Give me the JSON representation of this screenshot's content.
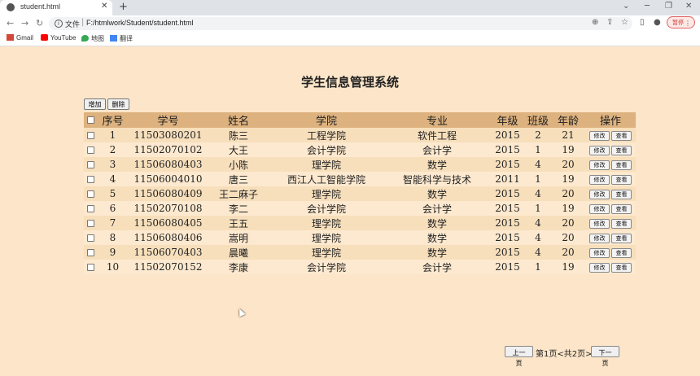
{
  "browser": {
    "tab_title": "student.html",
    "new_tab": "+",
    "address_label": "文件",
    "address_sep": "|",
    "url": "F:/htmlwork/Student/student.html",
    "profile_label": "暂停",
    "bookmarks": [
      {
        "label": "Gmail",
        "icon": "gmail-icon",
        "color": "#d44638"
      },
      {
        "label": "YouTube",
        "icon": "youtube-icon",
        "color": "#ff0000"
      },
      {
        "label": "地图",
        "icon": "maps-icon",
        "color": "#34a853"
      },
      {
        "label": "翻译",
        "icon": "translate-icon",
        "color": "#4285f4"
      }
    ]
  },
  "page": {
    "title": "学生信息管理系统",
    "add_label": "增加",
    "delete_label": "删除"
  },
  "table": {
    "headers": [
      "序号",
      "学号",
      "姓名",
      "学院",
      "专业",
      "年级",
      "班级",
      "年龄",
      "操作"
    ],
    "edit_label": "修改",
    "view_label": "查看",
    "rows": [
      {
        "no": "1",
        "id": "11503080201",
        "name": "陈三",
        "college": "工程学院",
        "major": "软件工程",
        "grade": "2015",
        "cls": "2",
        "age": "21"
      },
      {
        "no": "2",
        "id": "11502070102",
        "name": "大王",
        "college": "会计学院",
        "major": "会计学",
        "grade": "2015",
        "cls": "1",
        "age": "19"
      },
      {
        "no": "3",
        "id": "11506080403",
        "name": "小陈",
        "college": "理学院",
        "major": "数学",
        "grade": "2015",
        "cls": "4",
        "age": "20"
      },
      {
        "no": "4",
        "id": "11506004010",
        "name": "唐三",
        "college": "西江人工智能学院",
        "major": "智能科学与技术",
        "grade": "2011",
        "cls": "1",
        "age": "19"
      },
      {
        "no": "5",
        "id": "11506080409",
        "name": "王二麻子",
        "college": "理学院",
        "major": "数学",
        "grade": "2015",
        "cls": "4",
        "age": "20"
      },
      {
        "no": "6",
        "id": "11502070108",
        "name": "李二",
        "college": "会计学院",
        "major": "会计学",
        "grade": "2015",
        "cls": "1",
        "age": "19"
      },
      {
        "no": "7",
        "id": "11506080405",
        "name": "王五",
        "college": "理学院",
        "major": "数学",
        "grade": "2015",
        "cls": "4",
        "age": "20"
      },
      {
        "no": "8",
        "id": "11506080406",
        "name": "嵩明",
        "college": "理学院",
        "major": "数学",
        "grade": "2015",
        "cls": "4",
        "age": "20"
      },
      {
        "no": "9",
        "id": "11506070403",
        "name": "晨曦",
        "college": "理学院",
        "major": "数学",
        "grade": "2015",
        "cls": "4",
        "age": "20"
      },
      {
        "no": "10",
        "id": "11502070152",
        "name": "李康",
        "college": "会计学院",
        "major": "会计学",
        "grade": "2015",
        "cls": "1",
        "age": "19"
      }
    ]
  },
  "pager": {
    "prev_label": "上一页",
    "info": "第1页<共2页>",
    "next_label": "下一页"
  },
  "colors": {
    "background": "#fce5c8",
    "header_row": "#ddb27f",
    "row_odd": "#f7dfbc",
    "row_even": "#fde9cf"
  }
}
